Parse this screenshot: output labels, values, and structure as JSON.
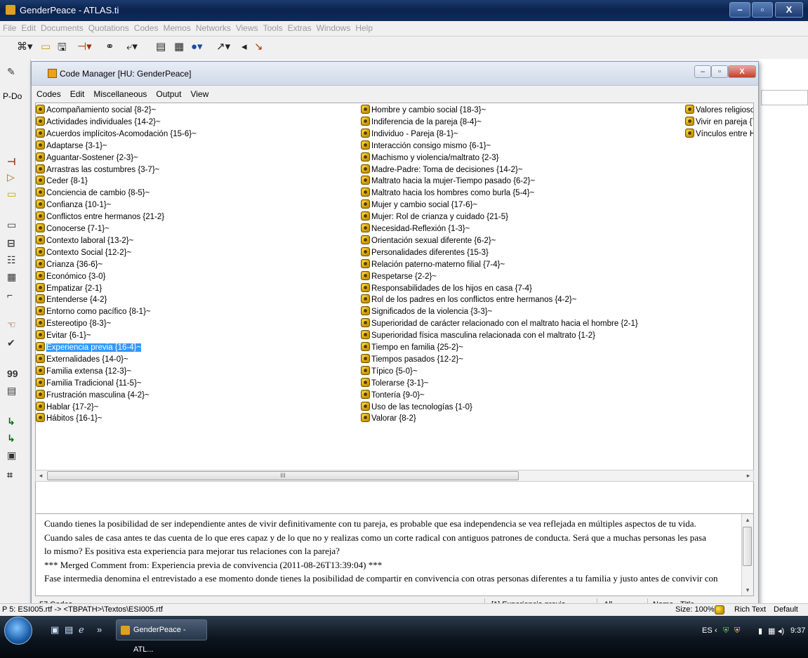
{
  "window": {
    "title": "GenderPeace - ATLAS.ti",
    "min_glyph": "–",
    "max_glyph": "▫",
    "close_glyph": "X"
  },
  "menubar": [
    "File",
    "Edit",
    "Documents",
    "Quotations",
    "Codes",
    "Memos",
    "Networks",
    "Views",
    "Tools",
    "Extras",
    "Windows",
    "Help"
  ],
  "toolbar_icons": [
    "tree-icon",
    "window-icon",
    "save-icon",
    "code-icon",
    "binoculars-icon",
    "open-icon",
    "doc-icon",
    "table-icon",
    "globe-icon",
    "pointer-icon",
    "arrow-icon",
    "check-icon"
  ],
  "left_strip_label": "P-Do",
  "left_strip_icons": [
    "pencil-icon",
    "coding-icon",
    "tag-icon",
    "panel-icon",
    "rect-icon",
    "split-icon",
    "layout-icon",
    "table-icon",
    "cursor-icon",
    "hand-icon",
    "check-icon",
    "quote-icon",
    "grid-icon",
    "code-link-icon",
    "code-link2-icon",
    "box-icon",
    "network-icon"
  ],
  "left_strip_text": "99",
  "code_manager": {
    "title": "Code Manager [HU: GenderPeace]",
    "menu": [
      "Codes",
      "Edit",
      "Miscellaneous",
      "Output",
      "View"
    ],
    "columns": [
      [
        "Acompañamiento social {8-2}~",
        "Actividades individuales {14-2}~",
        "Acuerdos implícitos-Acomodación {15-6}~",
        "Adaptarse {3-1}~",
        "Aguantar-Sostener {2-3}~",
        "Arrastras las costumbres {3-7}~",
        "Ceder {8-1}",
        "Conciencia de cambio {8-5}~",
        "Confianza {10-1}~",
        "Conflictos entre hermanos {21-2}",
        "Conocerse {7-1}~",
        "Contexto laboral {13-2}~",
        "Contexto Social {12-2}~",
        "Crianza {36-6}~",
        "Económico {3-0}",
        "Empatizar {2-1}",
        "Entenderse {4-2}",
        "Entorno como pacífico {8-1}~",
        "Estereotipo {8-3}~",
        "Evitar {6-1}~",
        "Experiencia previa {16-4}~",
        "Externalidades {14-0}~",
        "Familia extensa {12-3}~",
        "Familia Tradicional {11-5}~",
        "Frustración masculina {4-2}~",
        "Hablar {17-2}~",
        "Hábitos {16-1}~"
      ],
      [
        "Hombre y cambio social {18-3}~",
        "Indiferencia de la pareja {8-4}~",
        "Individuo - Pareja {8-1}~",
        "Interacción consigo mismo {6-1}~",
        "Machismo y violencia/maltrato {2-3}",
        "Madre-Padre: Toma de decisiones {14-2}~",
        "Maltrato hacia la mujer-Tiempo pasado {6-2}~",
        "Maltrato hacia los hombres como burla {5-4}~",
        "Mujer y cambio social {17-6}~",
        "Mujer: Rol de crianza y cuidado {21-5}",
        "Necesidad-Reflexión {1-3}~",
        "Orientación sexual diferente {6-2}~",
        "Personalidades diferentes {15-3}",
        "Relación paterno-materno filial {7-4}~",
        "Respetarse {2-2}~",
        "Responsabilidades de los hijos en casa {7-4}",
        "Rol de los padres en los conflictos entre hermanos {4-2}~",
        "Significados de la violencia {3-3}~",
        "Superioridad de carácter relacionado con el maltrato hacia el hombre {2-1}",
        "Superioridad física masculina relacionada con el maltrato {1-2}",
        "Tiempo en familia {25-2}~",
        "Tiempos pasados {12-2}~",
        "Típico {5-0}~",
        "Tolerarse {3-1}~",
        "Tontería {9-0}~",
        "Uso de las tecnologías {1-0}",
        "Valorar {8-2}"
      ],
      [
        "Valores religiosos",
        "Vivir en pareja {7-",
        "Vínculos entre He"
      ]
    ],
    "selected_code": "Experiencia previa {16-4}~",
    "scroll_grip": "III",
    "comment_lines": [
      "Cuando tienes la posibilidad de ser independiente antes de vivir definitivamente con tu pareja, es probable que esa independencia se vea reflejada en múltiples aspectos de tu vida.",
      "Cuando sales de casa antes te das cuenta de lo que eres capaz y de lo que no  y realizas como un corte radical con antiguos patrones de conducta. Será que a muchas personas les pasa",
      "lo mismo? Es positiva esta experiencia para mejorar tus relaciones con la pareja?",
      "*** Merged Comment from: Experiencia previa de convivencia (2011-08-26T13:39:04) ***",
      "Fase intermedia denomina el entrevistado a ese momento donde tienes la posibilidad de compartir en convivencia con otras personas diferentes a tu familia y justo antes de convivir con"
    ],
    "status": {
      "count": "57 Codes",
      "current": "[1] Experiencia previa",
      "filter": "All",
      "sort": "Name - Title"
    }
  },
  "statusbar": {
    "path": "P 5: ESI005.rtf -> <TBPATH>\\Textos\\ESI005.rtf",
    "size": "Size: 100%",
    "format": "Rich Text",
    "mode": "Default"
  },
  "taskbar": {
    "task_label": "GenderPeace - ATL...",
    "lang": "ES",
    "time": "9:37"
  }
}
